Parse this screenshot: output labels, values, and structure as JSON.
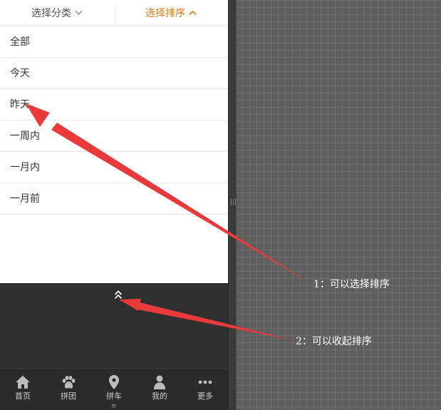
{
  "tabs": [
    {
      "label": "选择分类",
      "state": "collapsed"
    },
    {
      "label": "选择排序",
      "state": "expanded"
    }
  ],
  "sort_options": [
    "全部",
    "今天",
    "昨天",
    "一周内",
    "一月内",
    "一月前"
  ],
  "nav": [
    {
      "label": "首页",
      "icon": "home-icon"
    },
    {
      "label": "拼团",
      "icon": "paw-icon"
    },
    {
      "label": "拼车",
      "icon": "map-pin-icon"
    },
    {
      "label": "我的",
      "icon": "user-icon"
    },
    {
      "label": "更多",
      "icon": "more-icon"
    }
  ],
  "annotations": [
    {
      "text": "1：可以选择排序"
    },
    {
      "text": "2：可以收起排序"
    }
  ],
  "colors": {
    "accent": "#e07a14",
    "arrow": "#e83a3a",
    "panel_bg": "#2f2f2f"
  }
}
